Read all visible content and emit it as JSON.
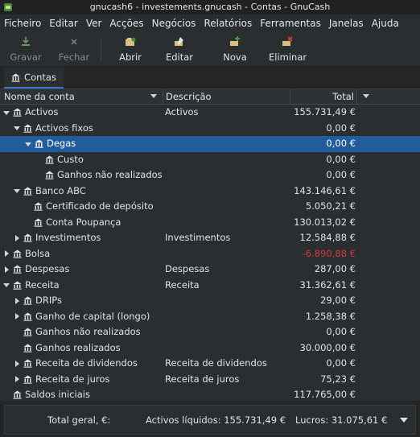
{
  "window": {
    "title": "gnucash6 - investements.gnucash - Contas - GnuCash"
  },
  "menu": [
    "Ficheiro",
    "Editar",
    "Ver",
    "Acções",
    "Negócios",
    "Relatórios",
    "Ferramentas",
    "Janelas",
    "Ajuda"
  ],
  "toolbar": {
    "save": "Gravar",
    "close": "Fechar",
    "open": "Abrir",
    "edit": "Editar",
    "new": "Nova",
    "delete": "Eliminar"
  },
  "tab": {
    "label": "Contas"
  },
  "columns": {
    "name": "Nome da conta",
    "description": "Descrição",
    "total": "Total"
  },
  "accounts": [
    {
      "name": "Activos",
      "description": "Activos",
      "total": "155.731,49 €"
    },
    {
      "name": "Activos fixos",
      "description": "",
      "total": "0,00 €"
    },
    {
      "name": "Degas",
      "description": "",
      "total": "0,00 €"
    },
    {
      "name": "Custo",
      "description": "",
      "total": "0,00 €"
    },
    {
      "name": "Ganhos não realizados",
      "description": "",
      "total": "0,00 €"
    },
    {
      "name": "Banco ABC",
      "description": "",
      "total": "143.146,61 €"
    },
    {
      "name": "Certificado de depósito",
      "description": "",
      "total": "5.050,21 €"
    },
    {
      "name": "Conta Poupança",
      "description": "",
      "total": "130.013,02 €"
    },
    {
      "name": "Investimentos",
      "description": "Investimentos",
      "total": "12.584,88 €"
    },
    {
      "name": "Bolsa",
      "description": "",
      "total": "-6.890,88 €"
    },
    {
      "name": "Despesas",
      "description": "Despesas",
      "total": "287,00 €"
    },
    {
      "name": "Receita",
      "description": "Receita",
      "total": "31.362,61 €"
    },
    {
      "name": "DRIPs",
      "description": "",
      "total": "29,00 €"
    },
    {
      "name": "Ganho de capital (longo)",
      "description": "",
      "total": "1.258,38 €"
    },
    {
      "name": "Ganhos não realizados",
      "description": "",
      "total": "0,00 €"
    },
    {
      "name": "Ganhos realizados",
      "description": "",
      "total": "30.000,00 €"
    },
    {
      "name": "Receita de dividendos",
      "description": "Receita de dividendos",
      "total": "0,00 €"
    },
    {
      "name": "Receita de juros",
      "description": "Receita de juros",
      "total": "75,23 €"
    },
    {
      "name": "Saldos iniciais",
      "description": "",
      "total": "117.765,00 €"
    }
  ],
  "summary": {
    "grand_total": "Total geral, €:",
    "net_assets": "Activos líquidos: 155.731,49 €",
    "profits": "Lucros: 31.075,61 €"
  },
  "colors": {
    "selection": "#215d9c",
    "negative": "#cf3b3b",
    "accent": "#3d7ad4"
  }
}
